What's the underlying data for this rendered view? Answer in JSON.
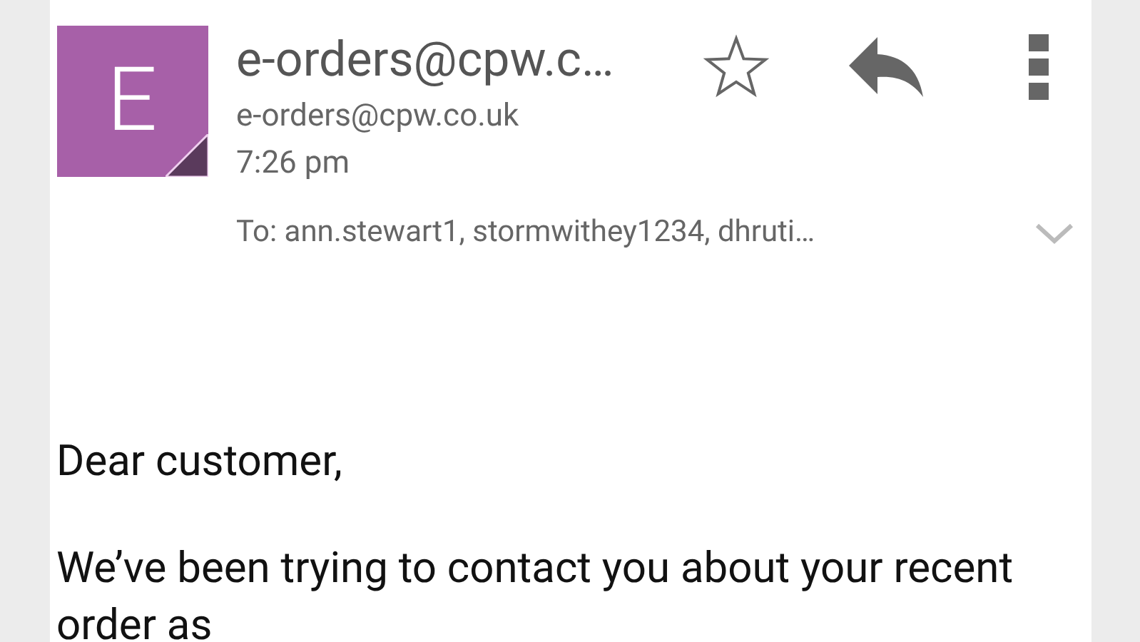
{
  "message": {
    "avatar_letter": "E",
    "sender_name": "e-orders@cpw.c…",
    "sender_email": "e-orders@cpw.co.uk",
    "time": "7:26 pm",
    "starred": false,
    "recipients": "To: ann.stewart1, stormwithey1234, dhruti…"
  },
  "body": [
    "Dear customer,",
    "We’ve been trying to contact you about your recent order as"
  ]
}
